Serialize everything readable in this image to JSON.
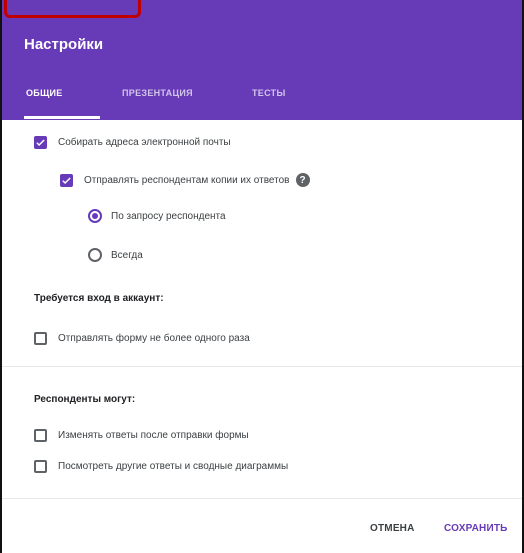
{
  "dialog": {
    "title": "Настройки",
    "tabs": [
      {
        "label": "ОБЩИЕ",
        "active": true
      },
      {
        "label": "ПРЕЗЕНТАЦИЯ",
        "active": false
      },
      {
        "label": "ТЕСТЫ",
        "active": false
      }
    ],
    "accent_color": "#673ab7"
  },
  "general": {
    "collect_emails": {
      "label": "Собирать адреса электронной почты",
      "checked": true
    },
    "send_copies": {
      "label": "Отправлять респондентам копии их ответов",
      "checked": true,
      "help_icon": "help-icon"
    },
    "send_mode": {
      "options": [
        {
          "label": "По запросу респондента",
          "selected": true
        },
        {
          "label": "Всегда",
          "selected": false
        }
      ]
    },
    "login_section": {
      "title": "Требуется вход в аккаунт:",
      "limit_one": {
        "label": "Отправлять форму не более одного раза",
        "checked": false
      }
    },
    "respondents_section": {
      "title": "Респонденты могут:",
      "edit_after": {
        "label": "Изменять ответы после отправки формы",
        "checked": false
      },
      "see_summary": {
        "label": "Посмотреть другие ответы и сводные диаграммы",
        "checked": false
      }
    }
  },
  "footer": {
    "cancel_label": "ОТМЕНА",
    "save_label": "СОХРАНИТЬ"
  }
}
